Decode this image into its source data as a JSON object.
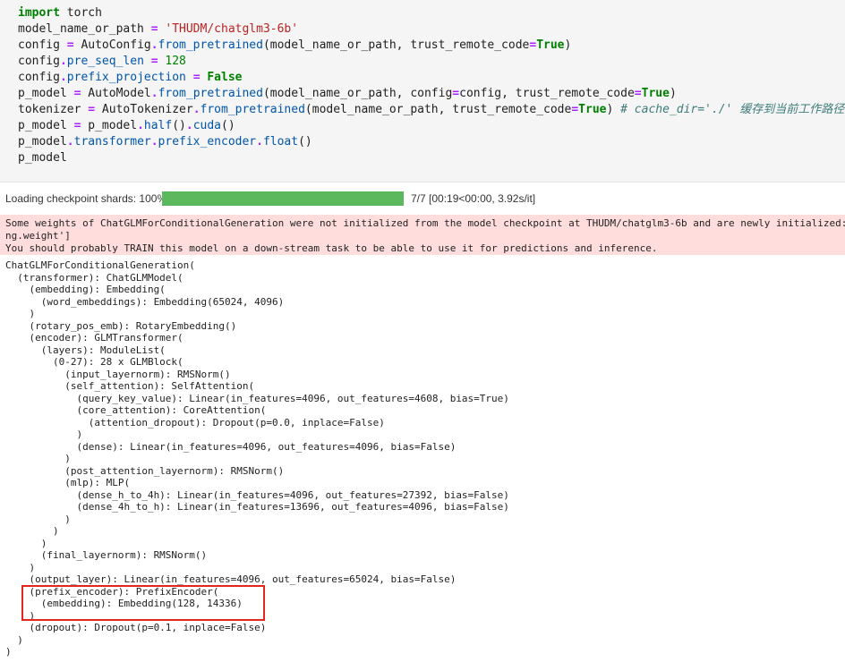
{
  "code_cell": {
    "lines": [
      [
        {
          "t": "import",
          "c": "kw"
        },
        {
          "t": " torch",
          "c": ""
        }
      ],
      [
        {
          "t": "model_name_or_path ",
          "c": ""
        },
        {
          "t": "=",
          "c": "op"
        },
        {
          "t": " ",
          "c": ""
        },
        {
          "t": "'THUDM/chatglm3-6b'",
          "c": "str"
        }
      ],
      [
        {
          "t": "config ",
          "c": ""
        },
        {
          "t": "=",
          "c": "op"
        },
        {
          "t": " AutoConfig",
          "c": ""
        },
        {
          "t": ".",
          "c": "op"
        },
        {
          "t": "from_pretrained",
          "c": "attr"
        },
        {
          "t": "(model_name_or_path, trust_remote_code",
          "c": ""
        },
        {
          "t": "=",
          "c": "op"
        },
        {
          "t": "True",
          "c": "kw"
        },
        {
          "t": ")",
          "c": ""
        }
      ],
      [
        {
          "t": "config",
          "c": ""
        },
        {
          "t": ".",
          "c": "op"
        },
        {
          "t": "pre_seq_len",
          "c": "attr"
        },
        {
          "t": " ",
          "c": ""
        },
        {
          "t": "=",
          "c": "op"
        },
        {
          "t": " ",
          "c": ""
        },
        {
          "t": "128",
          "c": "num"
        }
      ],
      [
        {
          "t": "config",
          "c": ""
        },
        {
          "t": ".",
          "c": "op"
        },
        {
          "t": "prefix_projection",
          "c": "attr"
        },
        {
          "t": " ",
          "c": ""
        },
        {
          "t": "=",
          "c": "op"
        },
        {
          "t": " ",
          "c": ""
        },
        {
          "t": "False",
          "c": "kw"
        }
      ],
      [
        {
          "t": "p_model ",
          "c": ""
        },
        {
          "t": "=",
          "c": "op"
        },
        {
          "t": " AutoModel",
          "c": ""
        },
        {
          "t": ".",
          "c": "op"
        },
        {
          "t": "from_pretrained",
          "c": "attr"
        },
        {
          "t": "(model_name_or_path, config",
          "c": ""
        },
        {
          "t": "=",
          "c": "op"
        },
        {
          "t": "config, trust_remote_code",
          "c": ""
        },
        {
          "t": "=",
          "c": "op"
        },
        {
          "t": "True",
          "c": "kw"
        },
        {
          "t": ")",
          "c": ""
        }
      ],
      [
        {
          "t": "tokenizer ",
          "c": ""
        },
        {
          "t": "=",
          "c": "op"
        },
        {
          "t": " AutoTokenizer",
          "c": ""
        },
        {
          "t": ".",
          "c": "op"
        },
        {
          "t": "from_pretrained",
          "c": "attr"
        },
        {
          "t": "(model_name_or_path, trust_remote_code",
          "c": ""
        },
        {
          "t": "=",
          "c": "op"
        },
        {
          "t": "True",
          "c": "kw"
        },
        {
          "t": ") ",
          "c": ""
        },
        {
          "t": "# cache_dir='./' 缓存到当前工作路径",
          "c": "cmt"
        }
      ],
      [
        {
          "t": "p_model ",
          "c": ""
        },
        {
          "t": "=",
          "c": "op"
        },
        {
          "t": " p_model",
          "c": ""
        },
        {
          "t": ".",
          "c": "op"
        },
        {
          "t": "half",
          "c": "attr"
        },
        {
          "t": "()",
          "c": ""
        },
        {
          "t": ".",
          "c": "op"
        },
        {
          "t": "cuda",
          "c": "attr"
        },
        {
          "t": "()",
          "c": ""
        }
      ],
      [
        {
          "t": "p_model",
          "c": ""
        },
        {
          "t": ".",
          "c": "op"
        },
        {
          "t": "transformer",
          "c": "attr"
        },
        {
          "t": ".",
          "c": "op"
        },
        {
          "t": "prefix_encoder",
          "c": "attr"
        },
        {
          "t": ".",
          "c": "op"
        },
        {
          "t": "float",
          "c": "attr"
        },
        {
          "t": "()",
          "c": ""
        }
      ],
      [
        {
          "t": "p_model",
          "c": ""
        }
      ]
    ]
  },
  "progress": {
    "label": "Loading checkpoint shards: 100%",
    "fraction": 1.0,
    "status": "7/7 [00:19<00:00, 3.92s/it]",
    "fill_color": "#5cb85c"
  },
  "stderr": {
    "lines": [
      "Some weights of ChatGLMForConditionalGeneration were not initialized from the model checkpoint at THUDM/chatglm3-6b and are newly initialized: ['t",
      "ng.weight']",
      "You should probably TRAIN this model on a down-stream task to be able to use it for predictions and inference."
    ],
    "bg_color": "#ffdddd"
  },
  "output": {
    "lines": [
      "ChatGLMForConditionalGeneration(",
      "  (transformer): ChatGLMModel(",
      "    (embedding): Embedding(",
      "      (word_embeddings): Embedding(65024, 4096)",
      "    )",
      "    (rotary_pos_emb): RotaryEmbedding()",
      "    (encoder): GLMTransformer(",
      "      (layers): ModuleList(",
      "        (0-27): 28 x GLMBlock(",
      "          (input_layernorm): RMSNorm()",
      "          (self_attention): SelfAttention(",
      "            (query_key_value): Linear(in_features=4096, out_features=4608, bias=True)",
      "            (core_attention): CoreAttention(",
      "              (attention_dropout): Dropout(p=0.0, inplace=False)",
      "            )",
      "            (dense): Linear(in_features=4096, out_features=4096, bias=False)",
      "          )",
      "          (post_attention_layernorm): RMSNorm()",
      "          (mlp): MLP(",
      "            (dense_h_to_4h): Linear(in_features=4096, out_features=27392, bias=False)",
      "            (dense_4h_to_h): Linear(in_features=13696, out_features=4096, bias=False)",
      "          )",
      "        )",
      "      )",
      "      (final_layernorm): RMSNorm()",
      "    )",
      "    (output_layer): Linear(in_features=4096, out_features=65024, bias=False)",
      "    (prefix_encoder): PrefixEncoder(",
      "      (embedding): Embedding(128, 14336)",
      "    )",
      "    (dropout): Dropout(p=0.1, inplace=False)",
      "  )",
      ")"
    ],
    "highlight_color": "#e3261c"
  }
}
